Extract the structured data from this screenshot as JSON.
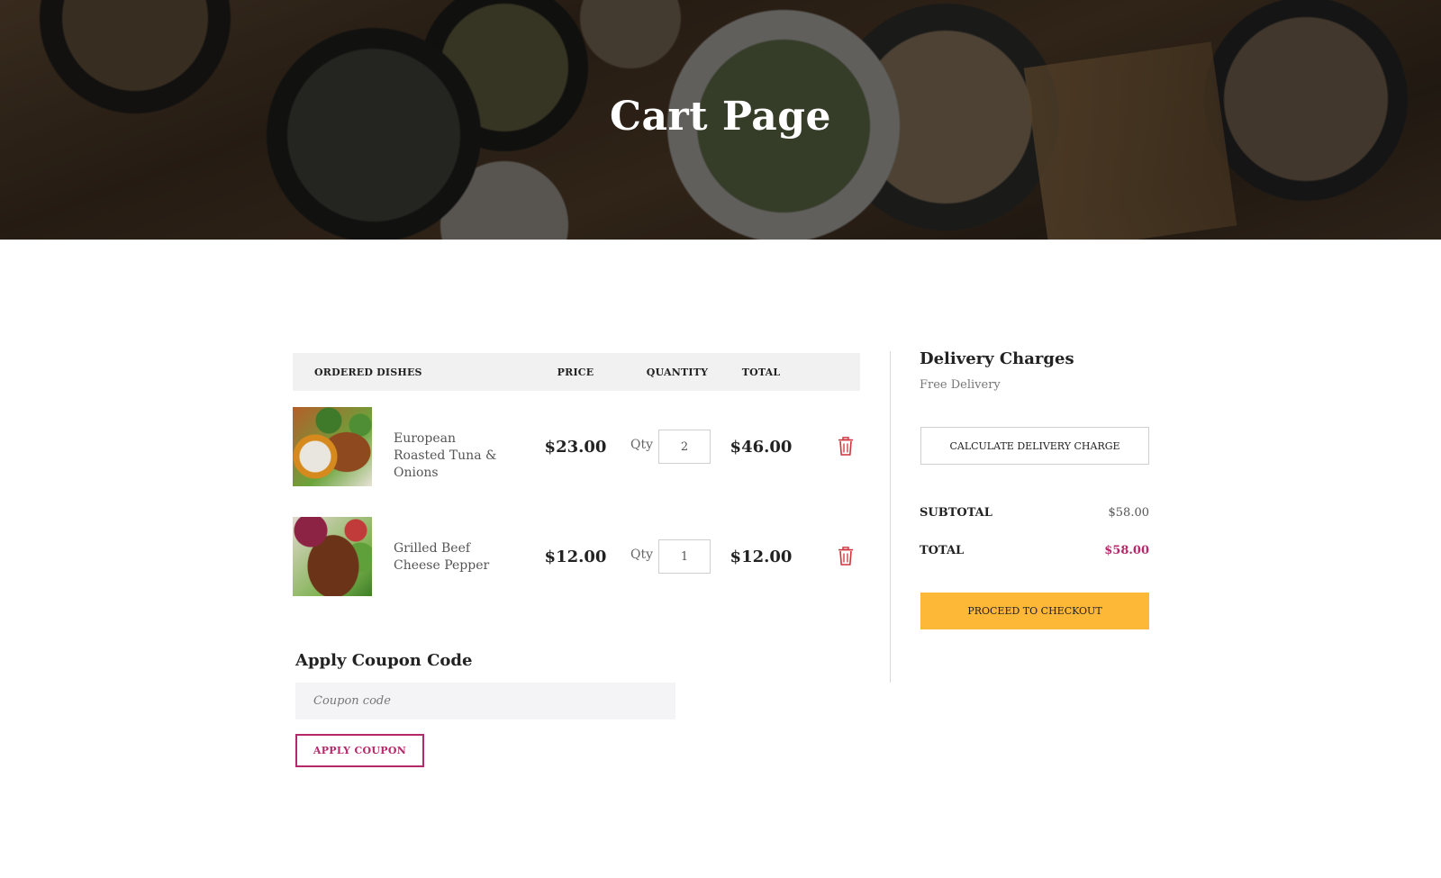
{
  "hero": {
    "title": "Cart Page"
  },
  "cart": {
    "columns": [
      "ORDERED DISHES",
      "PRICE",
      "QUANTITY",
      "TOTAL"
    ],
    "items": [
      {
        "name": "European Roasted Tuna & Onions",
        "price": "$23.00",
        "qty_label": "Qty",
        "qty": "2",
        "total": "$46.00"
      },
      {
        "name": "Grilled Beef Cheese Pepper",
        "price": "$12.00",
        "qty_label": "Qty",
        "qty": "1",
        "total": "$12.00"
      }
    ],
    "delete_icon": "trash-icon"
  },
  "coupon": {
    "title": "Apply Coupon Code",
    "placeholder": "Coupon code",
    "button": "APPLY COUPON"
  },
  "summary": {
    "delivery_title": "Delivery Charges",
    "delivery_sub": "Free Delivery",
    "calc_button": "CALCULATE DELIVERY CHARGE",
    "subtotal_label": "SUBTOTAL",
    "subtotal_value": "$58.00",
    "total_label": "TOTAL",
    "total_value": "$58.00",
    "checkout_button": "PROCEED TO CHECKOUT"
  },
  "colors": {
    "accent": "#b5286a",
    "checkout": "#fdb838",
    "trash": "#d0343f",
    "header_bg": "#f1f1f2"
  }
}
